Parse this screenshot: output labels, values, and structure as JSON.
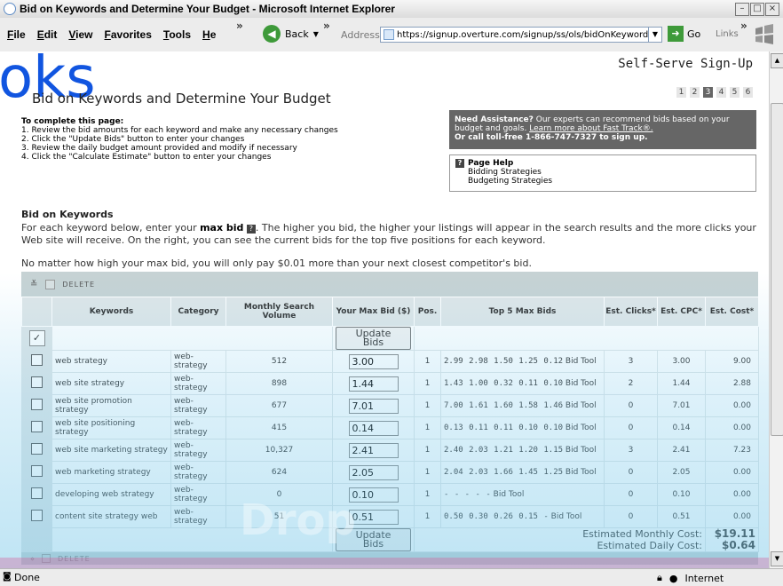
{
  "window": {
    "title": "Bid on Keywords and Determine Your Budget - Microsoft Internet Explorer",
    "min": "–",
    "max": "□",
    "close": "×"
  },
  "menu": [
    "File",
    "Edit",
    "View",
    "Favorites",
    "Tools",
    "He"
  ],
  "toolbar": {
    "back_label": "Back",
    "address_label": "Address",
    "url": "https://signup.overture.com/signup/ss/ols/bidOnKeywords.do",
    "go_label": "Go",
    "links_label": "Links"
  },
  "page": {
    "brand": "Self-Serve Sign-Up",
    "heading": "Bid on Keywords and Determine Your Budget",
    "books": "oks",
    "steps": [
      "1",
      "2",
      "3",
      "4",
      "5",
      "6"
    ],
    "current_step": "3",
    "instructions": {
      "title": "To complete this page:",
      "items": [
        "1. Review the bid amounts for each keyword and make any necessary changes",
        "2. Click the \"Update Bids\" button to enter your changes",
        "3. Review the daily budget amount provided and modify if necessary",
        "4. Click the \"Calculate Estimate\" button to enter your changes"
      ]
    },
    "assist": {
      "bold": "Need Assistance?",
      "text": " Our experts can recommend bids based on your budget and goals. ",
      "link": "Learn more about Fast Track®.",
      "call": "Or call toll-free 1-866-747-7327 to sign up."
    },
    "page_help": {
      "title": "Page Help",
      "links": [
        "Bidding Strategies",
        "Budgeting Strategies"
      ]
    },
    "bid_section": {
      "title": "Bid on Keywords",
      "text_before": "For each keyword below, enter your ",
      "text_bold": "max bid",
      "text_after": ". The higher you bid, the higher your listings will appear in the search results and the more clicks your Web site will receive. On the right, you can see the current bids for the top five positions for each keyword.",
      "note": "No matter how high your max bid, you will only pay $0.01 more than your next closest competitor's bid."
    }
  },
  "table": {
    "delete_label": "Delete",
    "select_all_glyph": "✓",
    "update_label": "Update Bids",
    "bid_tool_label": "Bid Tool",
    "headers": {
      "keywords": "Keywords",
      "category": "Category",
      "volume": "Monthly Search Volume",
      "maxbid": "Your Max Bid ($)",
      "pos": "Pos.",
      "top5": "Top 5 Max Bids",
      "clicks": "Est. Clicks*",
      "cpc": "Est. CPC*",
      "cost": "Est. Cost*"
    },
    "rows": [
      {
        "keyword": "web strategy",
        "category": "web-strategy",
        "volume": "512",
        "maxbid": "3.00",
        "pos": "1",
        "top5": "2.99 2.98 1.50 1.25 0.12",
        "clicks": "3",
        "cpc": "3.00",
        "cost": "9.00"
      },
      {
        "keyword": "web site strategy",
        "category": "web-strategy",
        "volume": "898",
        "maxbid": "1.44",
        "pos": "1",
        "top5": "1.43 1.00 0.32 0.11 0.10",
        "clicks": "2",
        "cpc": "1.44",
        "cost": "2.88"
      },
      {
        "keyword": "web site promotion strategy",
        "category": "web-strategy",
        "volume": "677",
        "maxbid": "7.01",
        "pos": "1",
        "top5": "7.00 1.61 1.60 1.58 1.46",
        "clicks": "0",
        "cpc": "7.01",
        "cost": "0.00"
      },
      {
        "keyword": "web site positioning strategy",
        "category": "web-strategy",
        "volume": "415",
        "maxbid": "0.14",
        "pos": "1",
        "top5": "0.13 0.11 0.11 0.10 0.10",
        "clicks": "0",
        "cpc": "0.14",
        "cost": "0.00"
      },
      {
        "keyword": "web site marketing strategy",
        "category": "web-strategy",
        "volume": "10,327",
        "maxbid": "2.41",
        "pos": "1",
        "top5": "2.40 2.03 1.21 1.20 1.15",
        "clicks": "3",
        "cpc": "2.41",
        "cost": "7.23"
      },
      {
        "keyword": "web marketing strategy",
        "category": "web-strategy",
        "volume": "624",
        "maxbid": "2.05",
        "pos": "1",
        "top5": "2.04 2.03 1.66 1.45 1.25",
        "clicks": "0",
        "cpc": "2.05",
        "cost": "0.00"
      },
      {
        "keyword": "developing web strategy",
        "category": "web-strategy",
        "volume": "0",
        "maxbid": "0.10",
        "pos": "1",
        "top5": "-    -    -    -    -",
        "clicks": "0",
        "cpc": "0.10",
        "cost": "0.00"
      },
      {
        "keyword": "content site strategy web",
        "category": "web-strategy",
        "volume": "51",
        "maxbid": "0.51",
        "pos": "1",
        "top5": "0.50 0.30 0.26 0.15  -",
        "clicks": "0",
        "cpc": "0.51",
        "cost": "0.00"
      }
    ],
    "totals": {
      "monthly_label": "Estimated Monthly Cost:",
      "monthly_value": "$19.11",
      "daily_label": "Estimated Daily Cost:",
      "daily_value": "$0.64"
    }
  },
  "watermark": {
    "text": "Drop"
  },
  "status": {
    "text": "Done",
    "zone": "Internet"
  }
}
